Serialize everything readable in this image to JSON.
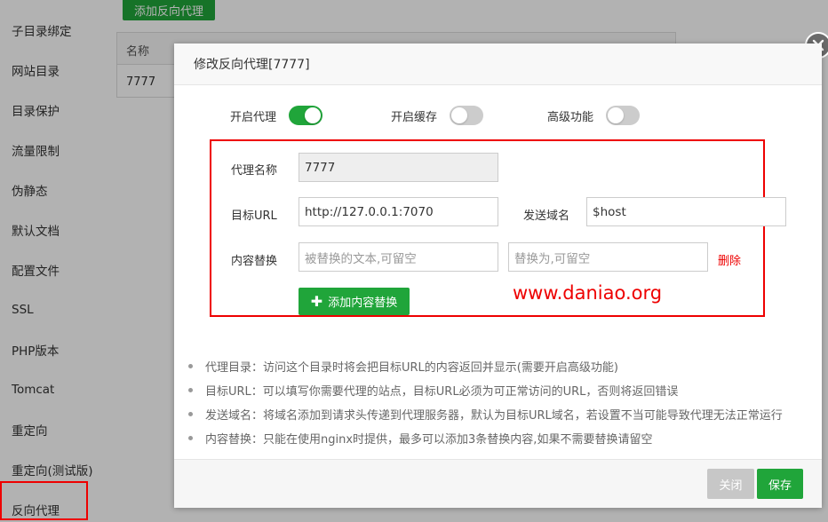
{
  "sidebar": {
    "items": [
      {
        "label": "子目录绑定"
      },
      {
        "label": "网站目录"
      },
      {
        "label": "目录保护"
      },
      {
        "label": "流量限制"
      },
      {
        "label": "伪静态"
      },
      {
        "label": "默认文档"
      },
      {
        "label": "配置文件"
      },
      {
        "label": "SSL"
      },
      {
        "label": "PHP版本"
      },
      {
        "label": "Tomcat"
      },
      {
        "label": "重定向"
      },
      {
        "label": "重定向(测试版)"
      },
      {
        "label": "反向代理"
      }
    ],
    "active_index": 12
  },
  "background": {
    "add_proxy_button": "添加反向代理",
    "table": {
      "header_name": "名称",
      "row_name": "7777"
    }
  },
  "dialog": {
    "title": "修改反向代理[7777]",
    "toggles": [
      {
        "label": "开启代理",
        "on": true
      },
      {
        "label": "开启缓存",
        "on": false
      },
      {
        "label": "高级功能",
        "on": false
      }
    ],
    "form": {
      "name_label": "代理名称",
      "name_value": "7777",
      "target_url_label": "目标URL",
      "target_url_value": "http://127.0.0.1:7070",
      "send_domain_label": "发送域名",
      "send_domain_value": "$host",
      "replace_label": "内容替换",
      "replace_from_placeholder": "被替换的文本,可留空",
      "replace_to_placeholder": "替换为,可留空",
      "delete_label": "删除",
      "add_replace_button": "添加内容替换"
    },
    "watermark": "www.daniao.org",
    "tips": [
      "代理目录：访问这个目录时将会把目标URL的内容返回并显示(需要开启高级功能)",
      "目标URL：可以填写你需要代理的站点，目标URL必须为可正常访问的URL，否则将返回错误",
      "发送域名：将域名添加到请求头传递到代理服务器，默认为目标URL域名，若设置不当可能导致代理无法正常运行",
      "内容替换：只能在使用nginx时提供，最多可以添加3条替换内容,如果不需要替换请留空"
    ],
    "footer": {
      "close_label": "关闭",
      "save_label": "保存"
    }
  },
  "colors": {
    "accent_green": "#20a53a",
    "highlight_red": "#e00000"
  }
}
